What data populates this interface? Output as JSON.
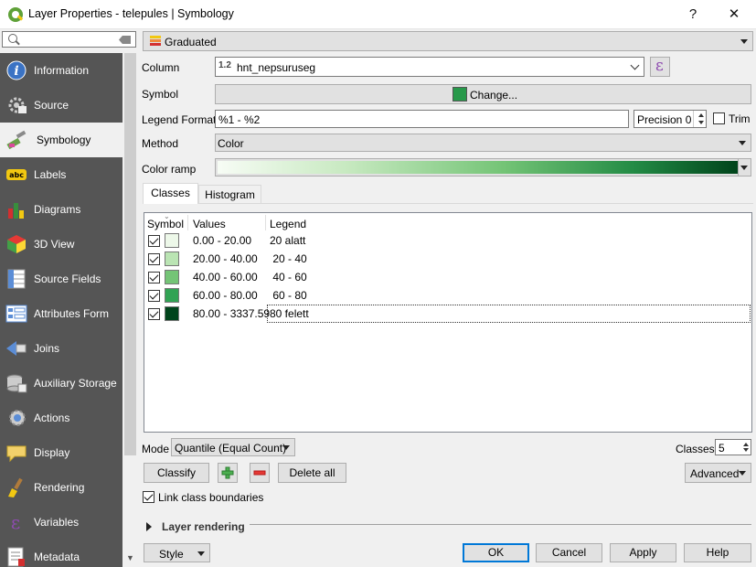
{
  "window": {
    "title": "Layer Properties - telepules | Symbology",
    "help_label": "?",
    "close_label": "✕"
  },
  "sidebar": {
    "search_placeholder": "",
    "items": [
      {
        "label": "Information",
        "icon": "information-icon"
      },
      {
        "label": "Source",
        "icon": "source-icon"
      },
      {
        "label": "Symbology",
        "icon": "symbology-icon",
        "active": true
      },
      {
        "label": "Labels",
        "icon": "labels-icon"
      },
      {
        "label": "Diagrams",
        "icon": "diagrams-icon"
      },
      {
        "label": "3D View",
        "icon": "3d-view-icon"
      },
      {
        "label": "Source Fields",
        "icon": "source-fields-icon"
      },
      {
        "label": "Attributes Form",
        "icon": "attributes-form-icon"
      },
      {
        "label": "Joins",
        "icon": "joins-icon"
      },
      {
        "label": "Auxiliary Storage",
        "icon": "auxiliary-storage-icon"
      },
      {
        "label": "Actions",
        "icon": "actions-icon"
      },
      {
        "label": "Display",
        "icon": "display-icon"
      },
      {
        "label": "Rendering",
        "icon": "rendering-icon"
      },
      {
        "label": "Variables",
        "icon": "variables-icon"
      },
      {
        "label": "Metadata",
        "icon": "metadata-icon"
      }
    ]
  },
  "renderer": {
    "type_label": "Graduated"
  },
  "form": {
    "column_label": "Column",
    "column_type": "1.2",
    "column_value": "hnt_nepsuruseg",
    "expression_icon": "ε",
    "symbol_label": "Symbol",
    "symbol_button": "Change...",
    "symbol_color": "#27994a",
    "legend_format_label": "Legend Format",
    "legend_format_value": "%1 - %2",
    "precision_label": "Precision 0",
    "trim_label": "Trim",
    "method_label": "Method",
    "method_value": "Color",
    "color_ramp_label": "Color ramp",
    "color_ramp_start": "#f7fcf5",
    "color_ramp_end": "#00441b"
  },
  "tabs": [
    {
      "label": "Classes",
      "active": true
    },
    {
      "label": "Histogram",
      "active": false
    }
  ],
  "classes_table": {
    "headers": {
      "symbol": "Symbol",
      "values": "Values",
      "legend": "Legend"
    },
    "rows": [
      {
        "checked": true,
        "color": "#edf8e9",
        "values": "0.00 - 20.00",
        "legend": "20 alatt"
      },
      {
        "checked": true,
        "color": "#bae4b3",
        "values": "20.00 - 40.00",
        "legend": " 20 - 40"
      },
      {
        "checked": true,
        "color": "#74c476",
        "values": "40.00 - 60.00",
        "legend": " 40 - 60"
      },
      {
        "checked": true,
        "color": "#31a354",
        "values": "60.00 - 80.00",
        "legend": " 60 - 80"
      },
      {
        "checked": true,
        "color": "#00441b",
        "values": "80.00 - 3337.59",
        "legend": "80 felett"
      }
    ]
  },
  "controls": {
    "mode_label": "Mode",
    "mode_value": "Quantile (Equal Count)",
    "classes_label": "Classes",
    "classes_value": "5",
    "classify_button": "Classify",
    "add_class_icon": "plus-icon",
    "remove_class_icon": "minus-icon",
    "delete_all_button": "Delete all",
    "advanced_button": "Advanced",
    "link_boundaries_label": "Link class boundaries",
    "link_boundaries_checked": true,
    "layer_rendering_label": "Layer rendering"
  },
  "footer": {
    "style_button": "Style",
    "ok_button": "OK",
    "cancel_button": "Cancel",
    "apply_button": "Apply",
    "help_button": "Help"
  }
}
